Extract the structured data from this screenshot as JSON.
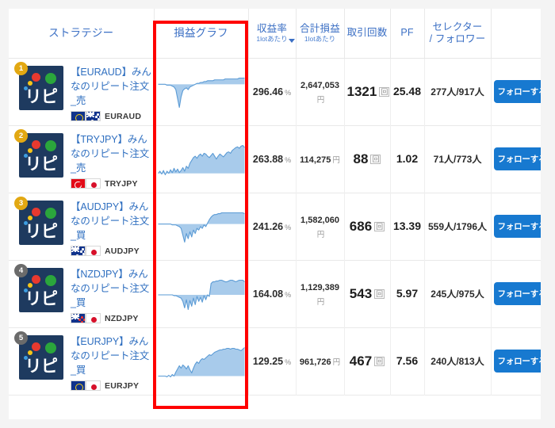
{
  "table": {
    "columns": [
      {
        "key": "strategy",
        "label": "ストラテジー",
        "sub": ""
      },
      {
        "key": "graph",
        "label": "損益グラフ",
        "sub": ""
      },
      {
        "key": "rate",
        "label": "収益率",
        "sub": "1lotあたり",
        "sorted": true
      },
      {
        "key": "pl",
        "label": "合計損益",
        "sub": "1lotあたり"
      },
      {
        "key": "trades",
        "label": "取引回数",
        "sub": ""
      },
      {
        "key": "pf",
        "label": "PF",
        "sub": ""
      },
      {
        "key": "selector",
        "label": "セレクター",
        "sub": "/ フォロワー"
      },
      {
        "key": "follow",
        "label": "",
        "sub": ""
      }
    ],
    "rows": [
      {
        "rank": "1",
        "rank_color": "#e2a812",
        "logo_text": "リピ",
        "name": "【EURAUD】みんなのリピート注文_売",
        "pair_code": "EURAUD",
        "flags": [
          "eu",
          "au"
        ],
        "rate": "296.46",
        "rate_unit": "%",
        "pl": "2,647,053",
        "pl_unit": "円",
        "pl_wraps": true,
        "trades": "1321",
        "trades_unit": "回",
        "pf": "25.48",
        "selector": "277人/917人",
        "follow_label": "フォローする"
      },
      {
        "rank": "2",
        "rank_color": "#e2a812",
        "logo_text": "リピ",
        "name": "【TRYJPY】みんなのリピート注文_売",
        "pair_code": "TRYJPY",
        "flags": [
          "tr",
          "jp"
        ],
        "rate": "263.88",
        "rate_unit": "%",
        "pl": "114,275",
        "pl_unit": "円",
        "pl_wraps": false,
        "trades": "88",
        "trades_unit": "回",
        "pf": "1.02",
        "selector": "71人/773人",
        "follow_label": "フォローする"
      },
      {
        "rank": "3",
        "rank_color": "#e2a812",
        "logo_text": "リピ",
        "name": "【AUDJPY】みんなのリピート注文_買",
        "pair_code": "AUDJPY",
        "flags": [
          "au",
          "jp"
        ],
        "rate": "241.26",
        "rate_unit": "%",
        "pl": "1,582,060",
        "pl_unit": "円",
        "pl_wraps": true,
        "trades": "686",
        "trades_unit": "回",
        "pf": "13.39",
        "selector": "559人/1796人",
        "follow_label": "フォローする"
      },
      {
        "rank": "4",
        "rank_color": "#6b6b6b",
        "logo_text": "リピ",
        "name": "【NZDJPY】みんなのリピート注文_買",
        "pair_code": "NZDJPY",
        "flags": [
          "nz",
          "jp"
        ],
        "rate": "164.08",
        "rate_unit": "%",
        "pl": "1,129,389",
        "pl_unit": "円",
        "pl_wraps": true,
        "trades": "543",
        "trades_unit": "回",
        "pf": "5.97",
        "selector": "245人/975人",
        "follow_label": "フォローする"
      },
      {
        "rank": "5",
        "rank_color": "#6b6b6b",
        "logo_text": "リピ",
        "name": "【EURJPY】みんなのリピート注文_買",
        "pair_code": "EURJPY",
        "flags": [
          "eu",
          "jp"
        ],
        "rate": "129.25",
        "rate_unit": "%",
        "pl": "961,726",
        "pl_unit": "円",
        "pl_wraps": false,
        "trades": "467",
        "trades_unit": "回",
        "pf": "7.56",
        "selector": "240人/813人",
        "follow_label": "フォローする"
      }
    ]
  },
  "annotation": {
    "highlight_color": "#ff0000",
    "highlight_target": "損益グラフ"
  },
  "colors": {
    "accent_blue": "#1779d0",
    "header_text": "#3b6fc4",
    "spark_line": "#5b9bd5",
    "spark_fill": "#a8cbeb",
    "logo_bg": "#1e3a5f"
  },
  "chart_data": [
    {
      "type": "area",
      "title": "EURAUD 損益グラフ",
      "series": [
        {
          "name": "損益",
          "values": [
            30,
            30,
            30,
            30,
            30,
            29,
            29,
            29,
            28,
            27,
            24,
            14,
            4,
            16,
            23,
            25,
            26,
            24,
            27,
            28,
            29,
            30,
            31,
            31,
            32,
            32,
            33,
            33,
            34,
            34,
            34,
            34,
            35,
            35,
            35,
            35,
            35,
            35,
            36,
            36,
            36,
            36,
            36,
            36,
            36,
            36,
            37,
            37,
            37,
            37
          ]
        }
      ],
      "ylabel": "",
      "xlabel": "",
      "grid": false,
      "legend": false
    },
    {
      "type": "area",
      "title": "TRYJPY 損益グラフ",
      "series": [
        {
          "name": "損益",
          "values": [
            6,
            9,
            5,
            10,
            4,
            9,
            6,
            11,
            7,
            13,
            8,
            12,
            7,
            10,
            14,
            9,
            16,
            13,
            20,
            24,
            28,
            30,
            27,
            31,
            33,
            30,
            34,
            33,
            30,
            28,
            31,
            34,
            30,
            26,
            30,
            33,
            31,
            29,
            32,
            35,
            36,
            34,
            38,
            40,
            42,
            43,
            41,
            44,
            45,
            42
          ]
        }
      ],
      "ylabel": "",
      "xlabel": "",
      "grid": false,
      "legend": false
    },
    {
      "type": "area",
      "title": "AUDJPY 損益グラフ",
      "series": [
        {
          "name": "損益",
          "values": [
            25,
            25,
            25,
            25,
            25,
            25,
            25,
            25,
            24,
            24,
            24,
            23,
            22,
            20,
            12,
            4,
            14,
            8,
            16,
            10,
            18,
            14,
            20,
            18,
            22,
            20,
            24,
            22,
            26,
            30,
            33,
            35,
            36,
            36,
            37,
            37,
            38,
            38,
            38,
            38,
            38,
            38,
            38,
            38,
            38,
            38,
            38,
            38,
            38,
            37
          ]
        }
      ],
      "ylabel": "",
      "xlabel": "",
      "grid": false,
      "legend": false
    },
    {
      "type": "area",
      "title": "NZDJPY 損益グラフ",
      "series": [
        {
          "name": "損益",
          "values": [
            22,
            22,
            22,
            22,
            22,
            22,
            22,
            22,
            22,
            21,
            21,
            20,
            19,
            18,
            14,
            6,
            16,
            4,
            15,
            8,
            18,
            10,
            20,
            14,
            19,
            13,
            21,
            16,
            22,
            20,
            36,
            38,
            38,
            39,
            39,
            40,
            40,
            39,
            38,
            38,
            39,
            40,
            40,
            39,
            38,
            39,
            40,
            40,
            40,
            38
          ]
        }
      ],
      "ylabel": "",
      "xlabel": "",
      "grid": false,
      "legend": false
    },
    {
      "type": "area",
      "title": "EURJPY 損益グラフ",
      "series": [
        {
          "name": "損益",
          "values": [
            8,
            8,
            8,
            8,
            8,
            7,
            9,
            7,
            10,
            8,
            13,
            17,
            21,
            18,
            22,
            20,
            17,
            21,
            16,
            12,
            18,
            23,
            26,
            24,
            28,
            30,
            29,
            31,
            33,
            35,
            34,
            36,
            38,
            39,
            40,
            41,
            41,
            42,
            42,
            43,
            43,
            42,
            43,
            43,
            42,
            42,
            41,
            40,
            42,
            44
          ]
        }
      ],
      "ylabel": "",
      "xlabel": "",
      "grid": false,
      "legend": false
    }
  ]
}
